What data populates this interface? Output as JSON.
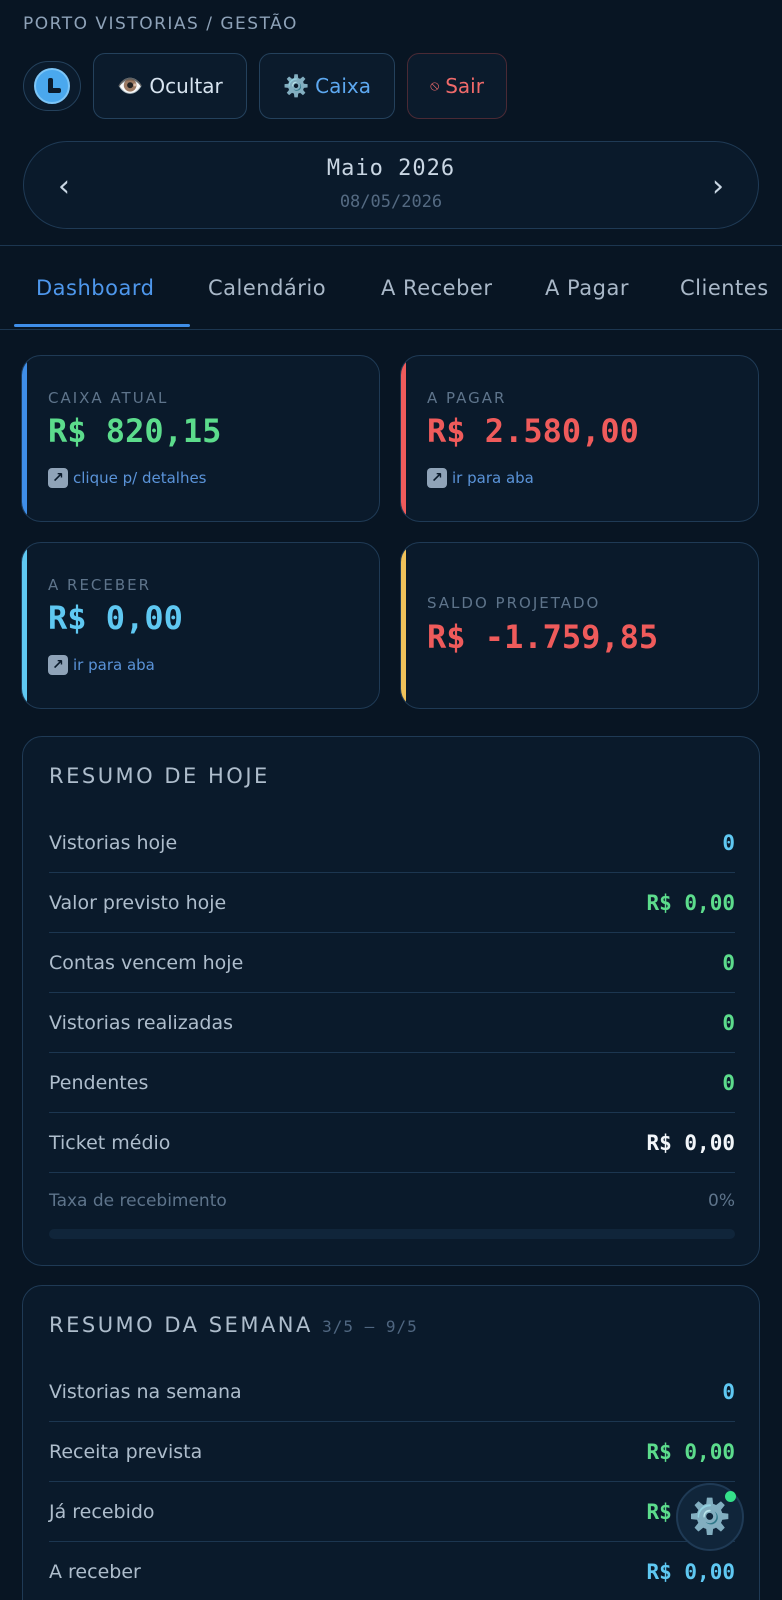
{
  "header": {
    "brand": "PORTO VISTORIAS / GESTÃO",
    "buttons": {
      "hide_label": "Ocultar",
      "caixa_label": "Caixa",
      "sair_label": "Sair"
    }
  },
  "month_nav": {
    "month": "Maio 2026",
    "date": "08/05/2026",
    "prev": "‹",
    "next": "›"
  },
  "tabs": [
    {
      "label": "Dashboard",
      "active": true
    },
    {
      "label": "Calendário"
    },
    {
      "label": "A Receber"
    },
    {
      "label": "A Pagar"
    },
    {
      "label": "Clientes"
    }
  ],
  "cards": {
    "caixa": {
      "label": "CAIXA ATUAL",
      "value": "R$ 820,15",
      "link": "clique p/ detalhes",
      "color": "#5cdc8c",
      "bar_color": "#3f8ee8"
    },
    "pagar": {
      "label": "A PAGAR",
      "value": "R$ 2.580,00",
      "link": "ir para aba",
      "color": "#ef5b5b",
      "bar_color": "#ef5b5b"
    },
    "receber": {
      "label": "A RECEBER",
      "value": "R$ 0,00",
      "link": "ir para aba",
      "color": "#5fc8f2",
      "bar_color": "#5fc8f2"
    },
    "saldo": {
      "label": "SALDO PROJETADO",
      "value": "R$ -1.759,85",
      "color": "#ef5b5b",
      "bar_color": "#f0c25a"
    }
  },
  "today": {
    "title": "RESUMO DE HOJE",
    "rows": [
      {
        "label": "Vistorias hoje",
        "value": "0",
        "color": "#5fc8f2"
      },
      {
        "label": "Valor previsto hoje",
        "value": "R$ 0,00",
        "color": "#5cdc8c"
      },
      {
        "label": "Contas vencem hoje",
        "value": "0",
        "color": "#5cdc8c"
      },
      {
        "label": "Vistorias realizadas",
        "value": "0",
        "color": "#5cdc8c"
      },
      {
        "label": "Pendentes",
        "value": "0",
        "color": "#5cdc8c"
      },
      {
        "label": "Ticket médio",
        "value": "R$ 0,00",
        "color": "#f2f6fa"
      }
    ],
    "rate_label": "Taxa de recebimento",
    "rate_value": "0%",
    "rate_fraction": 0
  },
  "week": {
    "title": "RESUMO DA SEMANA",
    "range": "3/5 – 9/5",
    "rows": [
      {
        "label": "Vistorias na semana",
        "value": "0",
        "color": "#5fc8f2"
      },
      {
        "label": "Receita prevista",
        "value": "R$ 0,00",
        "color": "#5cdc8c"
      },
      {
        "label": "Já recebido",
        "value": "R$ 0,00",
        "color": "#5cdc8c"
      },
      {
        "label": "A receber",
        "value": "R$ 0,00",
        "color": "#5fc8f2"
      }
    ]
  },
  "icons": {
    "eye": "eye-icon",
    "gear": "gear-icon",
    "sair": "sair-icon",
    "link_arrow": "arrow-up-right-icon",
    "fab": "gear-icon"
  }
}
